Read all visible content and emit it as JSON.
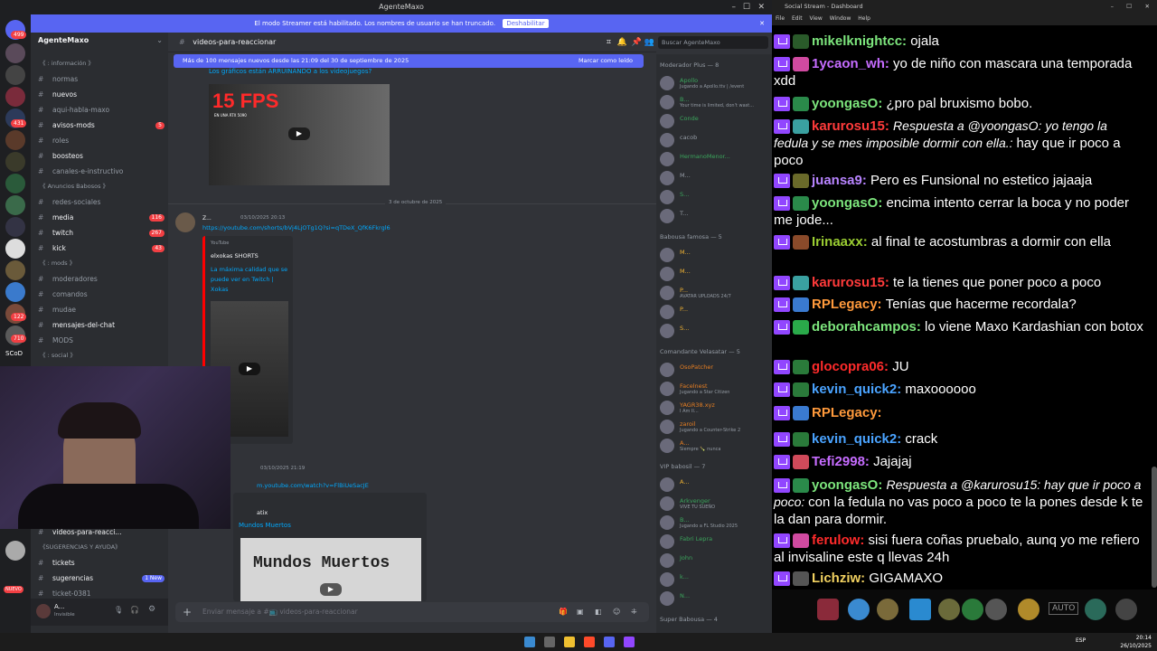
{
  "discord": {
    "window_title": "AgenteMaxo",
    "streamer_banner": "El modo Streamer está habilitado. Los nombres de usuario se han truncado.",
    "streamer_button": "Deshabilitar",
    "server_name": "AgenteMaxo",
    "channel_header": "videos-para-reaccionar",
    "search_placeholder": "Buscar AgenteMaxo",
    "new_messages": "Más de 100 mensajes nuevos desde las 21:09 del 30 de septiembre de 2025",
    "mark_read": "Marcar como leído",
    "composer_placeholder": "Enviar mensaje a #📺 videos-para-reaccionar",
    "channels": [
      {
        "type": "cat",
        "label": "《 : información 》"
      },
      {
        "type": "ch",
        "label": "normas",
        "bright": false
      },
      {
        "type": "ch",
        "label": "nuevos",
        "bright": true
      },
      {
        "type": "ch",
        "label": "aqui-habla-maxo",
        "bright": false
      },
      {
        "type": "ch",
        "label": "avisos-mods",
        "bright": true,
        "badge": "5"
      },
      {
        "type": "ch",
        "label": "roles",
        "bright": false
      },
      {
        "type": "ch",
        "label": "boosteos",
        "bright": true
      },
      {
        "type": "ch",
        "label": "canales-e-instructivo",
        "bright": false
      },
      {
        "type": "cat",
        "label": "《 Anuncios Babosos 》"
      },
      {
        "type": "ch",
        "label": "redes-sociales",
        "bright": false
      },
      {
        "type": "ch",
        "label": "media",
        "bright": true,
        "badge": "116"
      },
      {
        "type": "ch",
        "label": "twitch",
        "bright": true,
        "badge": "267"
      },
      {
        "type": "ch",
        "label": "kick",
        "bright": true,
        "badge": "43"
      },
      {
        "type": "cat",
        "label": "《 : mods 》"
      },
      {
        "type": "ch",
        "label": "moderadores",
        "bright": false
      },
      {
        "type": "ch",
        "label": "comandos",
        "bright": false
      },
      {
        "type": "ch",
        "label": "mudae",
        "bright": false
      },
      {
        "type": "ch",
        "label": "mensajes-del-chat",
        "bright": true
      },
      {
        "type": "ch",
        "label": "MODS",
        "bright": false
      },
      {
        "type": "cat",
        "label": "《 : social 》"
      }
    ],
    "channels_bottom": [
      {
        "type": "ch",
        "label": "videos-para-reacci...",
        "bright": true
      },
      {
        "type": "cat",
        "label": "《SUGERENCIAS Y AYUDA》"
      },
      {
        "type": "ch",
        "label": "tickets",
        "bright": true
      },
      {
        "type": "ch",
        "label": "sugerencias",
        "bright": true,
        "badge": "1 New"
      },
      {
        "type": "ch",
        "label": "ticket-0381",
        "bright": false
      }
    ],
    "user_status_name": "A...",
    "user_status": "Invisible",
    "messages": {
      "link_top": "Los gráficos están ARRUINANDO a los videojuegos?",
      "thumb1_text": "15 FPS",
      "thumb1_sub": "EN UNA RTX 5090",
      "date_divider": "3 de octubre de 2025",
      "msg1_user": "Z...",
      "msg1_time": "03/10/2025 20:13",
      "msg1_link": "https://youtube.com/shorts/bVj4LjOTg1Q?si=qTDeX_QfK6Fkrgl6",
      "embed_source": "YouTube",
      "embed_author": "elxokas SHORTS",
      "embed_title": "La máxima calidad que se puede ver en Twitch | Xokas",
      "msg2_time": "03/10/2025 21:19",
      "msg2_link": "m.youtube.com/watch?v=FlBiUeSacJE",
      "embed2_author": "atix",
      "embed2_title": "Mundos Muertos",
      "thumb3_text": "Mundos Muertos"
    },
    "member_groups": [
      {
        "title": "Moderador Plus — 8",
        "members": [
          {
            "name": "Apollo",
            "sub": "Jugando a Apollo.ttv | /event",
            "color": "#3ba55c"
          },
          {
            "name": "B...",
            "sub": "Your time is limited, don't wast...",
            "color": "#3ba55c"
          },
          {
            "name": "Conde",
            "sub": "",
            "color": "#3ba55c"
          },
          {
            "name": "cacob",
            "sub": "",
            "color": "#949ba4"
          },
          {
            "name": "HermanoMenor...",
            "sub": "",
            "color": "#3ba55c"
          },
          {
            "name": "M...",
            "sub": "",
            "color": "#949ba4"
          },
          {
            "name": "S...",
            "sub": "",
            "color": "#3ba55c"
          },
          {
            "name": "T...",
            "sub": "",
            "color": "#949ba4"
          }
        ]
      },
      {
        "title": "Babousa famosa — 5",
        "members": [
          {
            "name": "M...",
            "sub": "",
            "color": "#f0b232"
          },
          {
            "name": "M...",
            "sub": "",
            "color": "#f0b232"
          },
          {
            "name": "P...",
            "sub": "AVATAR UPLOADS 24/7",
            "color": "#f0b232"
          },
          {
            "name": "P...",
            "sub": "",
            "color": "#f0b232"
          },
          {
            "name": "S...",
            "sub": "",
            "color": "#f0b232"
          }
        ]
      },
      {
        "title": "Comandante Velasatar — 5",
        "members": [
          {
            "name": "OsoPatcher",
            "sub": "",
            "color": "#e67e22"
          },
          {
            "name": "Facelnest",
            "sub": "Jugando a Star Citizen",
            "color": "#e67e22"
          },
          {
            "name": "YAGR38.xyz",
            "sub": "I Am II...",
            "color": "#e67e22"
          },
          {
            "name": "zaroil",
            "sub": "Jugando a Counter-Strike 2",
            "color": "#e67e22"
          },
          {
            "name": "A...",
            "sub": "Siempre 🍾 nunca",
            "color": "#e67e22"
          }
        ]
      },
      {
        "title": "VIP babosil — 7",
        "members": [
          {
            "name": "A...",
            "sub": "",
            "color": "#f0b232"
          },
          {
            "name": "Arkvenger",
            "sub": "VIVE TU SUEÑO",
            "color": "#3ba55c"
          },
          {
            "name": "B...",
            "sub": "Jugando a FL Studio 2025",
            "color": "#3ba55c"
          },
          {
            "name": "Fabri Lepra",
            "sub": "",
            "color": "#3ba55c"
          },
          {
            "name": "John",
            "sub": "",
            "color": "#3ba55c"
          },
          {
            "name": "k...",
            "sub": "",
            "color": "#3ba55c"
          },
          {
            "name": "N...",
            "sub": "",
            "color": "#3ba55c"
          }
        ]
      },
      {
        "title": "Super Babousa — 4",
        "members": []
      }
    ]
  },
  "chat": {
    "window_title": "Social Stream - Dashboard",
    "menu": [
      "File",
      "Edit",
      "View",
      "Window",
      "Help"
    ],
    "messages": [
      {
        "user": "mikelknightcc:",
        "color": "#7de67d",
        "text": "ojala",
        "reply": ""
      },
      {
        "user": "1ycaon_wh:",
        "color": "#c66cff",
        "text": "yo de niño con mascara una temporada xdd",
        "reply": ""
      },
      {
        "user": "yoongasO:",
        "color": "#7de67d",
        "text": "¿pro pal bruxismo bobo.",
        "reply": ""
      },
      {
        "user": "karurosu15:",
        "color": "#ff3b3b",
        "text": "hay que ir poco a poco",
        "reply": "Respuesta a @yoongasO: yo tengo la fedula y se mes imposible dormir con ella.:"
      },
      {
        "user": "juansa9:",
        "color": "#b884ff",
        "text": "Pero es Funsional no estetico jajaaja",
        "reply": ""
      },
      {
        "user": "yoongasO:",
        "color": "#7de67d",
        "text": "encima intento cerrar la boca y no poder me jode...",
        "reply": ""
      },
      {
        "user": "Irinaaxx:",
        "color": "#9acd32",
        "text": "al final te acostumbras a dormir con ella",
        "reply": ""
      },
      {
        "user": "karurosu15:",
        "color": "#ff3b3b",
        "text": "te la tienes que poner poco a poco",
        "reply": ""
      },
      {
        "user": "RPLegacy:",
        "color": "#ff9a3c",
        "text": "Tenías que hacerme recordala?",
        "reply": ""
      },
      {
        "user": "deborahcampos:",
        "color": "#7de67d",
        "text": "lo viene Maxo Kardashian con botox",
        "reply": ""
      },
      {
        "user": "glocopra06:",
        "color": "#ff2b2b",
        "text": "JU",
        "reply": ""
      },
      {
        "user": "kevin_quick2:",
        "color": "#4aa3ff",
        "text": "maxoooooo",
        "reply": ""
      },
      {
        "user": "RPLegacy:",
        "color": "#ff9a3c",
        "text": "",
        "reply": ""
      },
      {
        "user": "kevin_quick2:",
        "color": "#4aa3ff",
        "text": "crack",
        "reply": ""
      },
      {
        "user": "Tefi2998:",
        "color": "#c66cff",
        "text": "Jajajaj",
        "reply": ""
      },
      {
        "user": "yoongasO:",
        "color": "#7de67d",
        "text": "con la fedula no vas poco a poco te la pones desde k te la dan para dormir.",
        "reply": "Respuesta a @karurosu15: hay que ir poco a poco:"
      },
      {
        "user": "ferulow:",
        "color": "#ff2b2b",
        "text": "sisi fuera coñas pruebalo, aunq yo me refiero al invisaline este q llevas 24h",
        "reply": ""
      },
      {
        "user": "Lichziw:",
        "color": "#f0d060",
        "text": "GIGAMAXO",
        "reply": ""
      }
    ],
    "auto_label": "AUTO"
  },
  "taskbar": {
    "lang": "ESP",
    "time": "20:14",
    "date": "26/10/2025"
  },
  "left_badges": [
    "499",
    "431",
    "122",
    "710"
  ],
  "left_labels": {
    "scod": "SCoD",
    "nuevo": "NUEVO"
  }
}
